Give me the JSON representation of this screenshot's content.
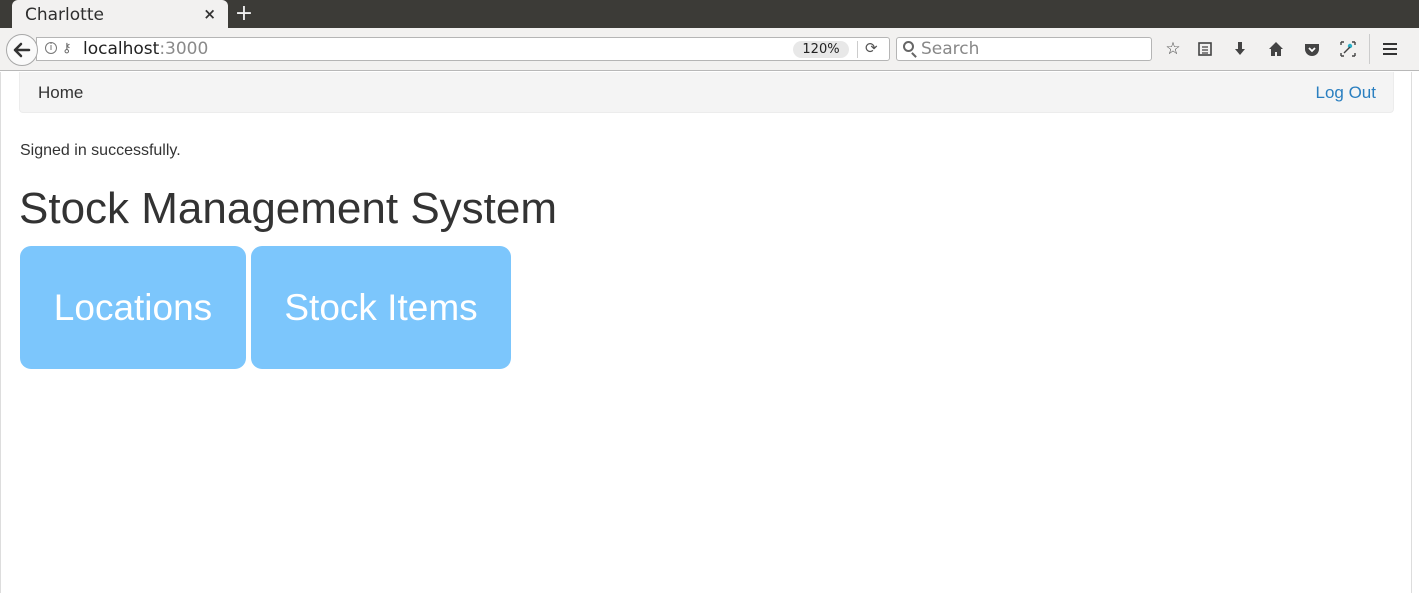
{
  "browser": {
    "tab_title": "Charlotte",
    "tab_close": "×",
    "new_tab": "+",
    "url_host": "localhost",
    "url_port": ":3000",
    "zoom": "120%",
    "search_placeholder": "Search"
  },
  "navbar": {
    "home_label": "Home",
    "logout_label": "Log Out",
    "logout_color": "#2a7fc0"
  },
  "main": {
    "flash": "Signed in successfully.",
    "title": "Stock Management System",
    "tiles": [
      {
        "label": "Locations",
        "color": "#7cc6fc"
      },
      {
        "label": "Stock Items",
        "color": "#7cc6fc"
      }
    ]
  }
}
